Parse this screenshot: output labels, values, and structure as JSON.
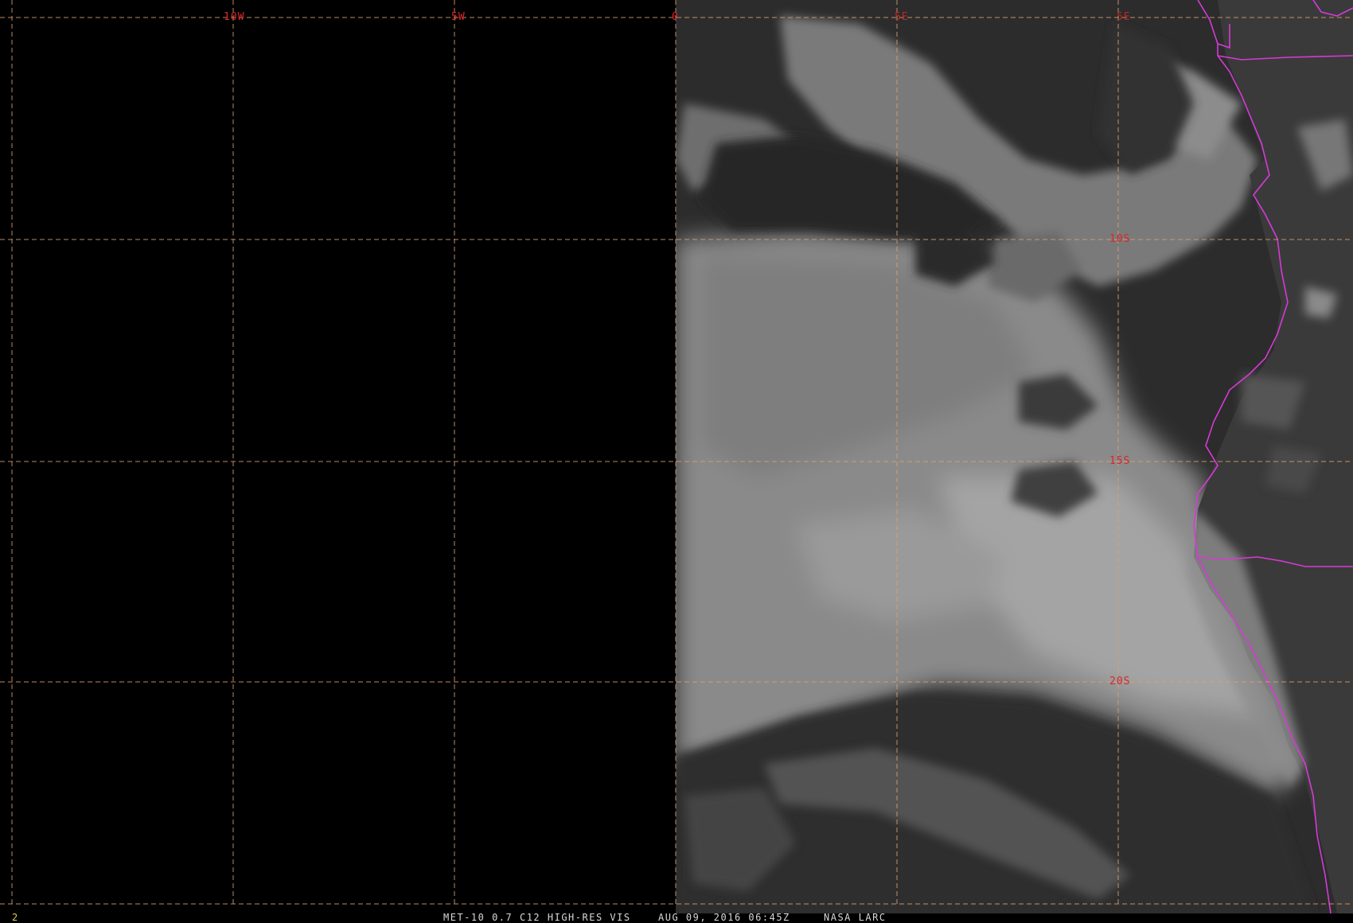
{
  "grid": {
    "longitude_labels": [
      "10W",
      "5W",
      "0",
      "5E",
      "5E"
    ],
    "latitude_labels": [
      "10S",
      "15S",
      "20S"
    ]
  },
  "footer": {
    "frame_number": "2",
    "product": "MET-10 0.7 C12 HIGH-RES VIS",
    "datetime": "AUG 09, 2016 06:45Z",
    "source": "NASA LARC"
  },
  "colors": {
    "gridline": "#e0a070",
    "grid_label": "#d8282a",
    "coastline": "#d63ad6",
    "no_data": "#000000",
    "ocean": "#2b2b2b",
    "cloud": "#9a9a9a",
    "land": "#3a3a3a"
  }
}
